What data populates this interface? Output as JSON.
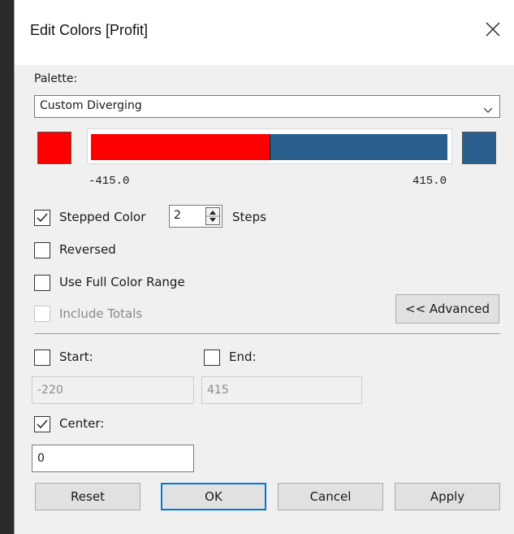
{
  "window": {
    "title": "Edit Colors [Profit]"
  },
  "palette": {
    "label": "Palette:",
    "selected": "Custom Diverging",
    "start_color": "#ff0000",
    "end_color": "#2a5e8c",
    "min_label": "-415.0",
    "max_label": "415.0"
  },
  "options": {
    "stepped": {
      "label": "Stepped Color",
      "checked": true,
      "steps_value": "2",
      "steps_label": "Steps"
    },
    "reversed": {
      "label": "Reversed",
      "checked": false
    },
    "full_range": {
      "label": "Use Full Color Range",
      "checked": false
    },
    "include_totals": {
      "label": "Include Totals",
      "checked": false,
      "disabled": true
    },
    "advanced_button": "<< Advanced"
  },
  "advanced": {
    "start": {
      "label": "Start:",
      "checked": false,
      "value": "-220"
    },
    "end": {
      "label": "End:",
      "checked": false,
      "value": "415"
    },
    "center": {
      "label": "Center:",
      "checked": true,
      "value": "0"
    }
  },
  "buttons": {
    "reset": "Reset",
    "ok": "OK",
    "cancel": "Cancel",
    "apply": "Apply"
  }
}
